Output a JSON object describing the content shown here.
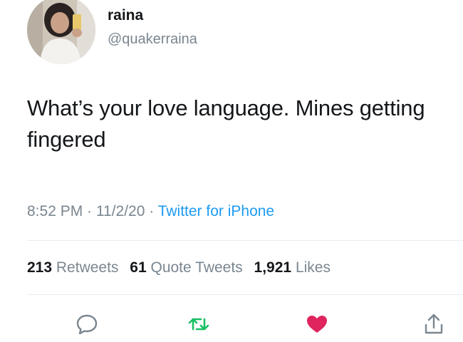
{
  "user": {
    "display_name": "raina",
    "handle": "@quakerraina",
    "avatar_icon": "profile-photo"
  },
  "tweet": {
    "text": "What’s your love language. Mines getting fingered",
    "time": "8:52 PM",
    "date": "11/2/20",
    "source": "Twitter for iPhone",
    "separator": " · "
  },
  "stats": {
    "retweets_count": "213",
    "retweets_label": "Retweets",
    "quotes_count": "61",
    "quotes_label": "Quote Tweets",
    "likes_count": "1,921",
    "likes_label": "Likes"
  },
  "actions": {
    "reply_icon": "reply-icon",
    "retweet_icon": "retweet-icon",
    "like_icon": "heart-icon",
    "share_icon": "share-icon"
  },
  "colors": {
    "text": "#14171a",
    "muted": "#7a8690",
    "link": "#1d9bf0",
    "retweet": "#17bf63",
    "like": "#e0245e"
  }
}
